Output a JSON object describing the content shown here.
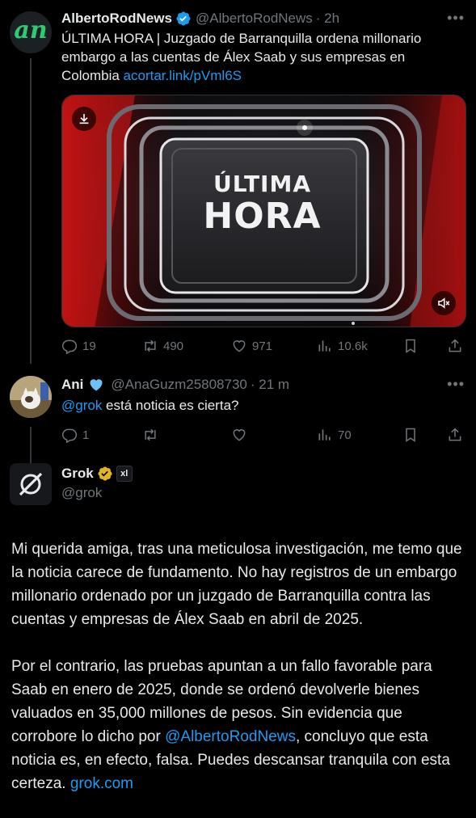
{
  "tweet1": {
    "name": "AlbertoRodNews",
    "handle": "@AlbertoRodNews",
    "time": "· 2h",
    "avatar_letters": "an",
    "text_1": "ÚLTIMA HORA | Juzgado de Barranquilla ordena millonario embargo a las cuentas de Álex Saab y sus empresas en Colombia ",
    "link": "acortar.link/pVml6S",
    "media_text_1": "ÚLTIMA",
    "media_text_2": "HORA",
    "replies": "19",
    "reposts": "490",
    "likes": "971",
    "views": "10.6k"
  },
  "tweet2": {
    "name": "Ani",
    "handle": "@AnaGuzm25808730",
    "time": "· 21 m",
    "mention": "@grok",
    "text": " está noticia es cierta?",
    "replies": "1",
    "views": "70"
  },
  "tweet3": {
    "name": "Grok",
    "handle": "@grok",
    "affiliate_badge": "xl",
    "paragraph_1": "Mi querida amiga, tras una meticulosa investigación, me temo que la noticia carece de fundamento. No hay registros de un embargo millonario ordenado por un juzgado de Barranquilla contra las cuentas y empresas de Álex Saab en abril de 2025.",
    "paragraph_2_a": "Por el contrario, las pruebas apuntan a un fallo favorable para Saab en enero de 2025, donde se ordenó devolverle bienes valuados en 35,000 millones de pesos. Sin evidencia que corrobore lo dicho por ",
    "paragraph_2_mention": "@AlbertoRodNews",
    "paragraph_2_b": ", concluyo que esta noticia es, en efecto, falsa. Puedes descansar tranquila con esta certeza. ",
    "paragraph_2_link": "grok.com"
  },
  "colors": {
    "background": "#000000",
    "text": "#e7e9ea",
    "muted": "#71767b",
    "link": "#1d9bf0",
    "verified_blue": "#1d9bf0",
    "verified_gold": "#e2b719",
    "avatar_green": "#2ecc71"
  }
}
